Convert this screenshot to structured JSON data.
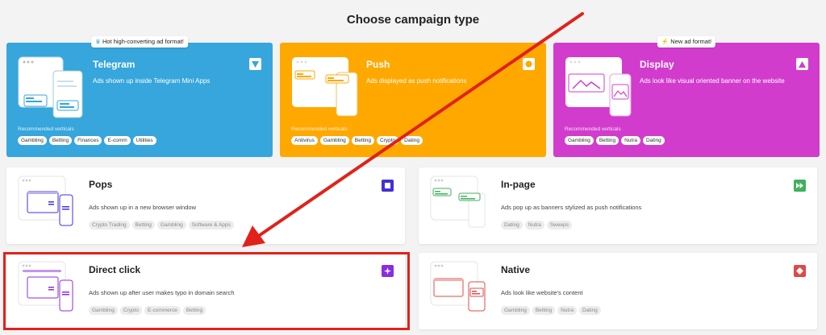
{
  "page": {
    "title": "Choose campaign type"
  },
  "colors": {
    "telegram": "#36a6dc",
    "push": "#ffa800",
    "display": "#d23ccd",
    "pops": "#4230d9",
    "inpage": "#3fb15b",
    "direct": "#8a2de2",
    "native": "#e14848",
    "arrow": "#e0221b"
  },
  "telegram": {
    "badge": "Hot high-converting ad format!",
    "badge_icon": "crown-icon",
    "name": "Telegram",
    "desc": "Ads shown up inside Telegram Mini Apps",
    "rec_label": "Recommended verticals",
    "tags": [
      "Gambling",
      "Betting",
      "Finances",
      "E-comm",
      "Utilities"
    ]
  },
  "push": {
    "name": "Push",
    "desc": "Ads displayed as push notifications",
    "rec_label": "Recommended verticals",
    "tags": [
      "Antivirus",
      "Gambling",
      "Betting",
      "Crypto",
      "Dating"
    ]
  },
  "display": {
    "badge": "New ad format!",
    "badge_icon": "lightning-icon",
    "name": "Display",
    "desc": "Ads look like visual oriented banner on the website",
    "rec_label": "Recommended verticals",
    "tags": [
      "Gambling",
      "Betting",
      "Nutra",
      "Dating"
    ]
  },
  "pops": {
    "name": "Pops",
    "desc": "Ads shown up in a new browser window",
    "tags": [
      "Crypto Trading",
      "Betting",
      "Gambling",
      "Software & Apps"
    ]
  },
  "inpage": {
    "name": "In-page",
    "desc": "Ads pop up as banners stylized as push notifications",
    "tags": [
      "Dating",
      "Nutra",
      "Sweeps"
    ]
  },
  "direct": {
    "name": "Direct click",
    "desc": "Ads shown up after user makes typo in domain search",
    "tags": [
      "Gambling",
      "Crypto",
      "E-commerce",
      "Betting"
    ]
  },
  "native": {
    "name": "Native",
    "desc": "Ads look like website's content",
    "tags": [
      "Gambling",
      "Betting",
      "Nutra",
      "Dating"
    ]
  }
}
